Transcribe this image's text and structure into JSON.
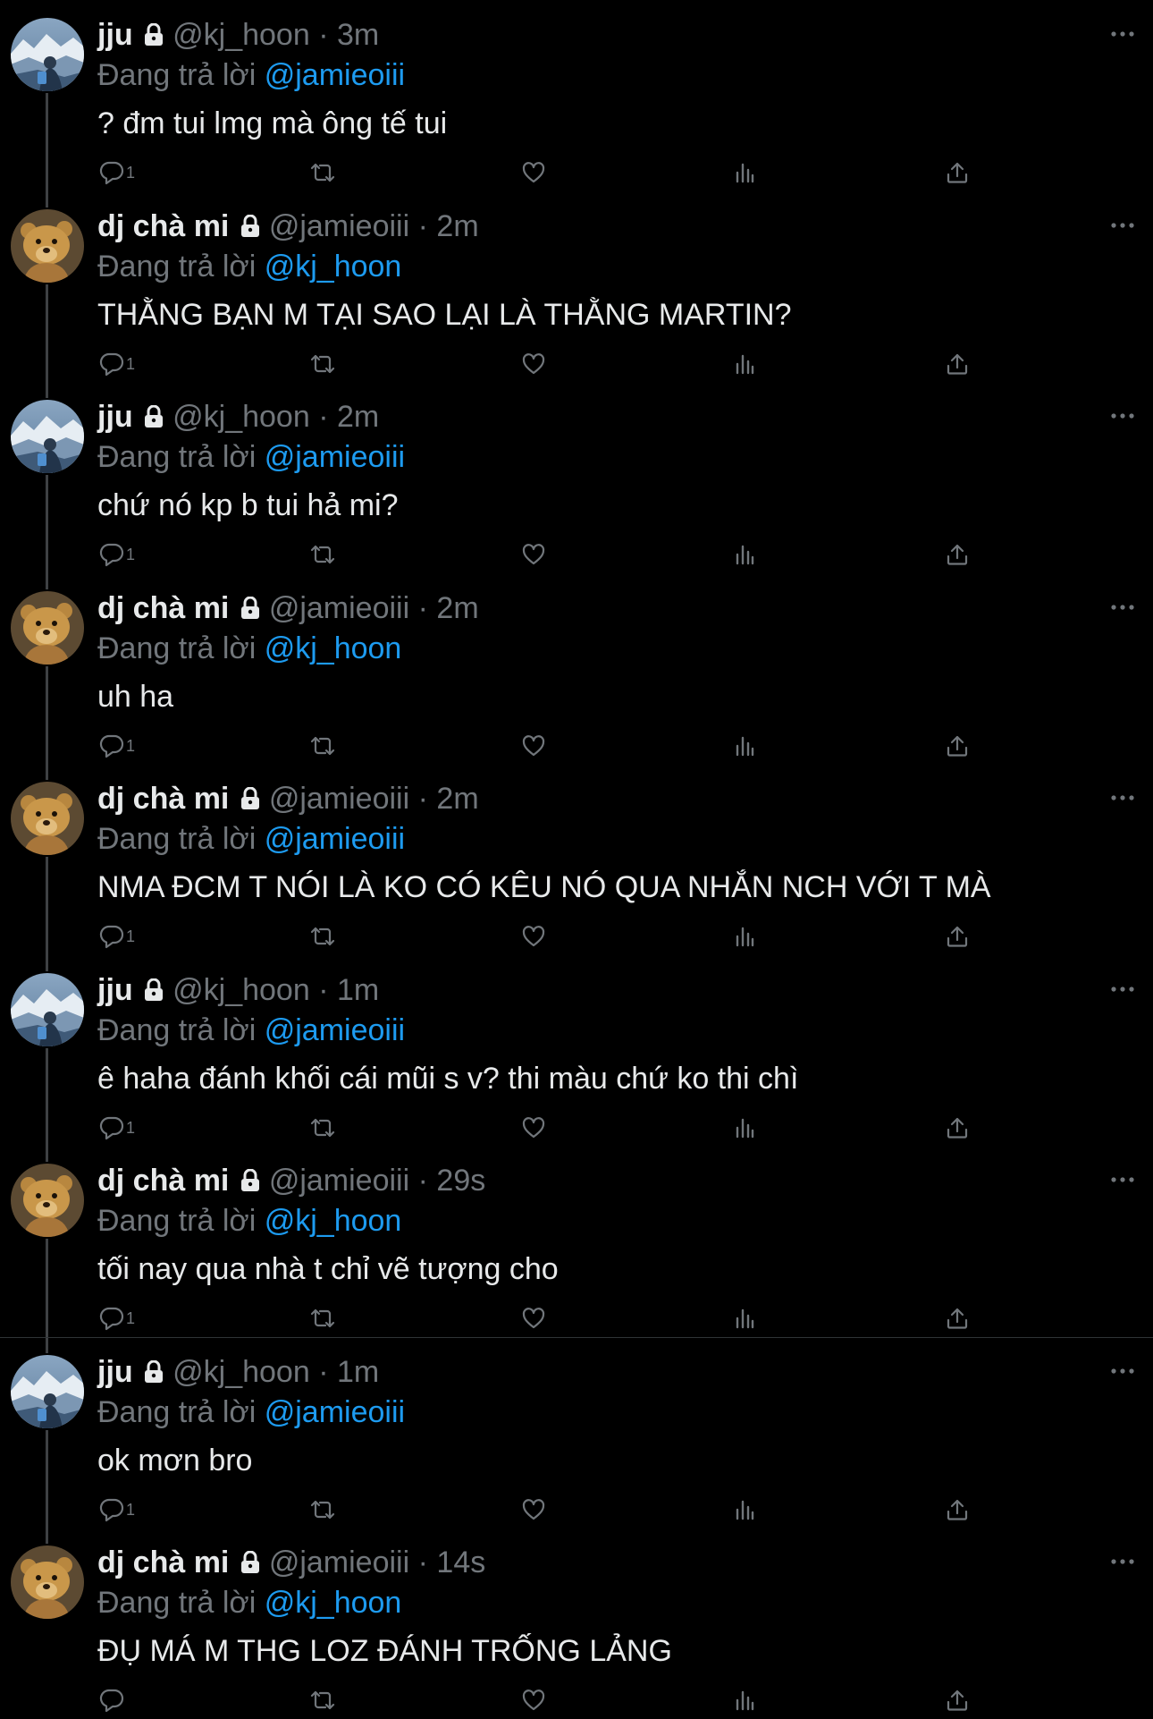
{
  "thread": {
    "replying_prefix": "Đang trả lời",
    "tweets": [
      {
        "name": "jju",
        "handle": "@kj_hoon",
        "dot": "·",
        "time": "3m",
        "replying_to": "@jamieoiii",
        "text": "? đm tui lmg mà ông tế tui",
        "reply_count": "1",
        "avatar": "mountain"
      },
      {
        "name": "dj chà mi",
        "handle": "@jamieoiii",
        "dot": "·",
        "time": "2m",
        "replying_to": "@kj_hoon",
        "text": "THẰNG BẠN M TẠI SAO LẠI LÀ THẰNG MARTIN?",
        "reply_count": "1",
        "avatar": "bear"
      },
      {
        "name": "jju",
        "handle": "@kj_hoon",
        "dot": "·",
        "time": "2m",
        "replying_to": "@jamieoiii",
        "text": "chứ nó kp b tui hả mi?",
        "reply_count": "1",
        "avatar": "mountain"
      },
      {
        "name": "dj chà mi",
        "handle": "@jamieoiii",
        "dot": "·",
        "time": "2m",
        "replying_to": "@kj_hoon",
        "text": "uh ha",
        "reply_count": "1",
        "avatar": "bear"
      },
      {
        "name": "dj chà mi",
        "handle": "@jamieoiii",
        "dot": "·",
        "time": "2m",
        "replying_to": "@jamieoiii",
        "text": "NMA ĐCM T NÓI LÀ KO CÓ KÊU NÓ QUA NHẮN NCH VỚI T MÀ",
        "reply_count": "1",
        "avatar": "bear"
      },
      {
        "name": "jju",
        "handle": "@kj_hoon",
        "dot": "·",
        "time": "1m",
        "replying_to": "@jamieoiii",
        "text": "ê haha đánh khối cái mũi s v? thi màu chứ ko thi chì",
        "reply_count": "1",
        "avatar": "mountain"
      },
      {
        "name": "dj chà mi",
        "handle": "@jamieoiii",
        "dot": "·",
        "time": "29s",
        "replying_to": "@kj_hoon",
        "text": "tối nay qua nhà t chỉ vẽ tượng cho",
        "reply_count": "1",
        "avatar": "bear"
      },
      {
        "name": "jju",
        "handle": "@kj_hoon",
        "dot": "·",
        "time": "1m",
        "replying_to": "@jamieoiii",
        "text": "ok mơn bro",
        "reply_count": "1",
        "avatar": "mountain"
      },
      {
        "name": "dj chà mi",
        "handle": "@jamieoiii",
        "dot": "·",
        "time": "14s",
        "replying_to": "@kj_hoon",
        "text": "ĐỤ MÁ M THG LOZ ĐÁNH TRỐNG LẢNG",
        "reply_count": "",
        "avatar": "bear"
      }
    ]
  },
  "icons": {
    "reply": "reply-icon",
    "retweet": "retweet-icon",
    "like": "heart-icon",
    "views": "views-icon",
    "share": "share-icon",
    "more": "more-icon",
    "lock": "lock-icon"
  },
  "colors": {
    "background": "#000000",
    "primary_text": "#e7e9ea",
    "secondary_text": "#71767b",
    "accent": "#1d9bf0",
    "thread_line": "#3e4144"
  }
}
